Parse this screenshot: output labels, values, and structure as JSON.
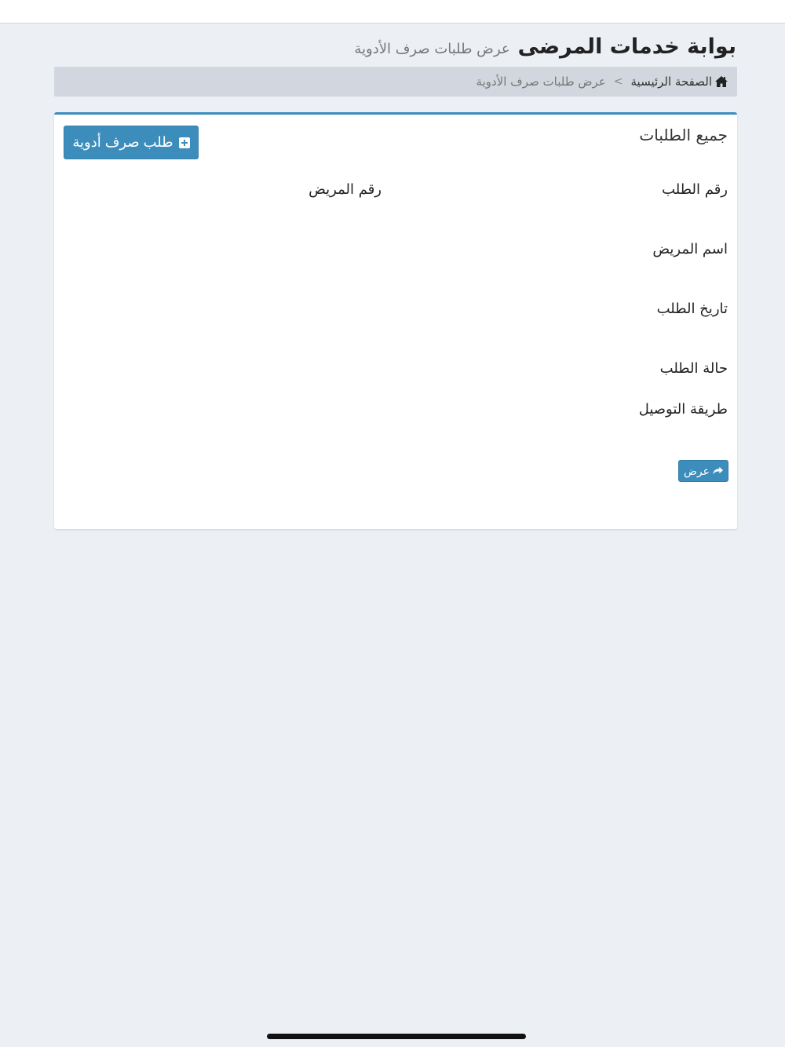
{
  "header": {
    "title": "بوابة خدمات المرضى",
    "subtitle": "عرض طلبات صرف الأدوية"
  },
  "breadcrumb": {
    "home_icon": "home-icon",
    "home_label": "الصفحة الرئيسية",
    "separator": ">",
    "current": "عرض طلبات صرف الأدوية"
  },
  "box": {
    "title": "جميع الطلبات",
    "new_request_label": "طلب صرف أدوية",
    "new_request_icon": "plus-square-icon",
    "accent_color": "#3c8dbc"
  },
  "fields": {
    "order_number": "رقم الطلب",
    "patient_number": "رقم المريض",
    "patient_name": "اسم المريض",
    "order_date": "تاريخ الطلب",
    "order_status": "حالة الطلب",
    "delivery_method": "طريقة التوصيل"
  },
  "actions": {
    "view_label": "عرض",
    "view_icon": "share-arrow-icon"
  }
}
